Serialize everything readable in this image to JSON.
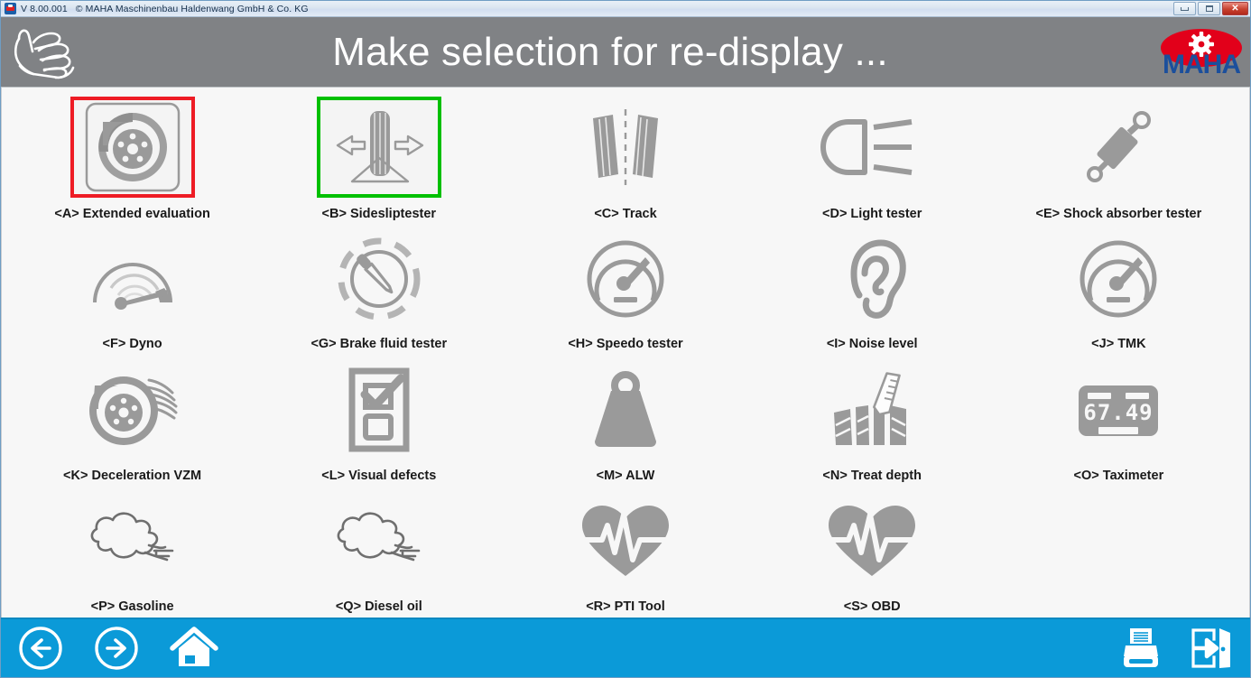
{
  "titlebar": {
    "app_icon": "maha-app-icon",
    "version": "V 8.00.001",
    "copyright": "© MAHA Maschinenbau Haldenwang GmbH & Co. KG",
    "buttons": {
      "minimize": "minimize",
      "maximize": "maximize",
      "close": "✕"
    }
  },
  "header": {
    "left_icon": "hand-icon",
    "title": "Make selection for re-display ...",
    "logo_text": "MAHA",
    "logo_colors": {
      "ellipse": "#e2001a",
      "text": "#1b4f9c",
      "gear": "#ffffff"
    }
  },
  "theme": {
    "header_bg": "#808285",
    "content_bg": "#f7f7f7",
    "footer_bg": "#0b9ad8",
    "icon_grey": "#9a9a9a",
    "selection_red": "#ee1c25",
    "selection_green": "#00c000",
    "label_color": "#1a1a1a"
  },
  "grid": {
    "columns": 5,
    "rows": 4,
    "items": [
      {
        "key": "A",
        "label": "<A> Extended evaluation",
        "icon": "brake-disc-boxed-icon",
        "selection": "red"
      },
      {
        "key": "B",
        "label": "<B> Sidesliptester",
        "icon": "sideslip-tester-icon",
        "selection": "green"
      },
      {
        "key": "C",
        "label": "<C> Track",
        "icon": "wheel-alignment-track-icon",
        "selection": "none"
      },
      {
        "key": "D",
        "label": "<D> Light tester",
        "icon": "headlamp-beam-icon",
        "selection": "none"
      },
      {
        "key": "E",
        "label": "<E> Shock absorber tester",
        "icon": "shock-absorber-icon",
        "selection": "none"
      },
      {
        "key": "F",
        "label": "<F> Dyno",
        "icon": "dyno-gauge-icon",
        "selection": "none"
      },
      {
        "key": "G",
        "label": "<G> Brake fluid tester",
        "icon": "brake-fluid-pipette-icon",
        "selection": "none"
      },
      {
        "key": "H",
        "label": "<H> Speedo tester",
        "icon": "speedometer-icon",
        "selection": "none"
      },
      {
        "key": "I",
        "label": "<I> Noise level",
        "icon": "ear-icon",
        "selection": "none"
      },
      {
        "key": "J",
        "label": "<J> TMK",
        "icon": "speedometer-icon",
        "selection": "none"
      },
      {
        "key": "K",
        "label": "<K> Deceleration VZM",
        "icon": "brake-disc-motion-icon",
        "selection": "none"
      },
      {
        "key": "L",
        "label": "<L> Visual defects",
        "icon": "checklist-form-icon",
        "selection": "none"
      },
      {
        "key": "M",
        "label": "<M> ALW",
        "icon": "weight-icon",
        "selection": "none"
      },
      {
        "key": "N",
        "label": "<N> Treat depth",
        "icon": "tread-depth-gauge-icon",
        "selection": "none"
      },
      {
        "key": "O",
        "label": "<O> Taximeter",
        "icon": "taximeter-display-icon",
        "selection": "none",
        "display_value": "67.49"
      },
      {
        "key": "P",
        "label": "<P> Gasoline",
        "icon": "exhaust-smoke-icon",
        "selection": "none"
      },
      {
        "key": "Q",
        "label": "<Q> Diesel oil",
        "icon": "exhaust-smoke-icon",
        "selection": "none"
      },
      {
        "key": "R",
        "label": "<R> PTI Tool",
        "icon": "heart-ecg-icon",
        "selection": "none"
      },
      {
        "key": "S",
        "label": "<S> OBD",
        "icon": "heart-ecg-icon",
        "selection": "none"
      },
      {
        "key": "",
        "label": "",
        "icon": "",
        "selection": "none"
      }
    ]
  },
  "footer": {
    "buttons": [
      {
        "name": "back-button",
        "icon": "circled-left-arrow-icon"
      },
      {
        "name": "forward-button",
        "icon": "circled-right-arrow-icon"
      },
      {
        "name": "home-button",
        "icon": "home-icon"
      },
      {
        "name": "print-button",
        "icon": "printer-icon"
      },
      {
        "name": "exit-button",
        "icon": "exit-door-icon"
      }
    ]
  }
}
